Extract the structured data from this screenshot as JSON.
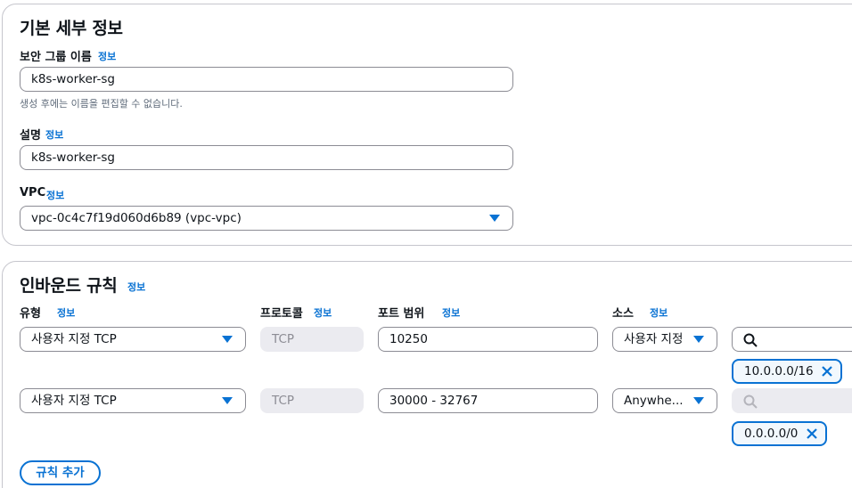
{
  "basic": {
    "title": "기본 세부 정보",
    "info": "정보",
    "sg_name_label": "보안 그룹 이름",
    "sg_name_value": "k8s-worker-sg",
    "sg_name_hint": "생성 후에는 이름을 편집할 수 없습니다.",
    "desc_label": "설명",
    "desc_value": "k8s-worker-sg",
    "vpc_label": "VPC",
    "vpc_value": "vpc-0c4c7f19d060d6b89 (vpc-vpc)"
  },
  "inbound": {
    "title": "인바운드 규칙",
    "info": "정보",
    "col_type": "유형",
    "col_protocol": "프로토콜",
    "col_port": "포트 범위",
    "col_source": "소스",
    "rows": [
      {
        "type": "사용자 지정 TCP",
        "protocol": "TCP",
        "port": "10250",
        "source": "사용자 지정",
        "search": "",
        "cidr": "10.0.0.0/16"
      },
      {
        "type": "사용자 지정 TCP",
        "protocol": "TCP",
        "port": "30000 - 32767",
        "source": "Anywhe...",
        "search": "",
        "cidr": "0.0.0.0/0"
      }
    ],
    "add_rule": "규칙 추가"
  },
  "colors": {
    "link": "#0972d3",
    "border": "#8c8c94",
    "disabled_bg": "#ebebf0",
    "chip_bg": "#f2f8fd"
  }
}
